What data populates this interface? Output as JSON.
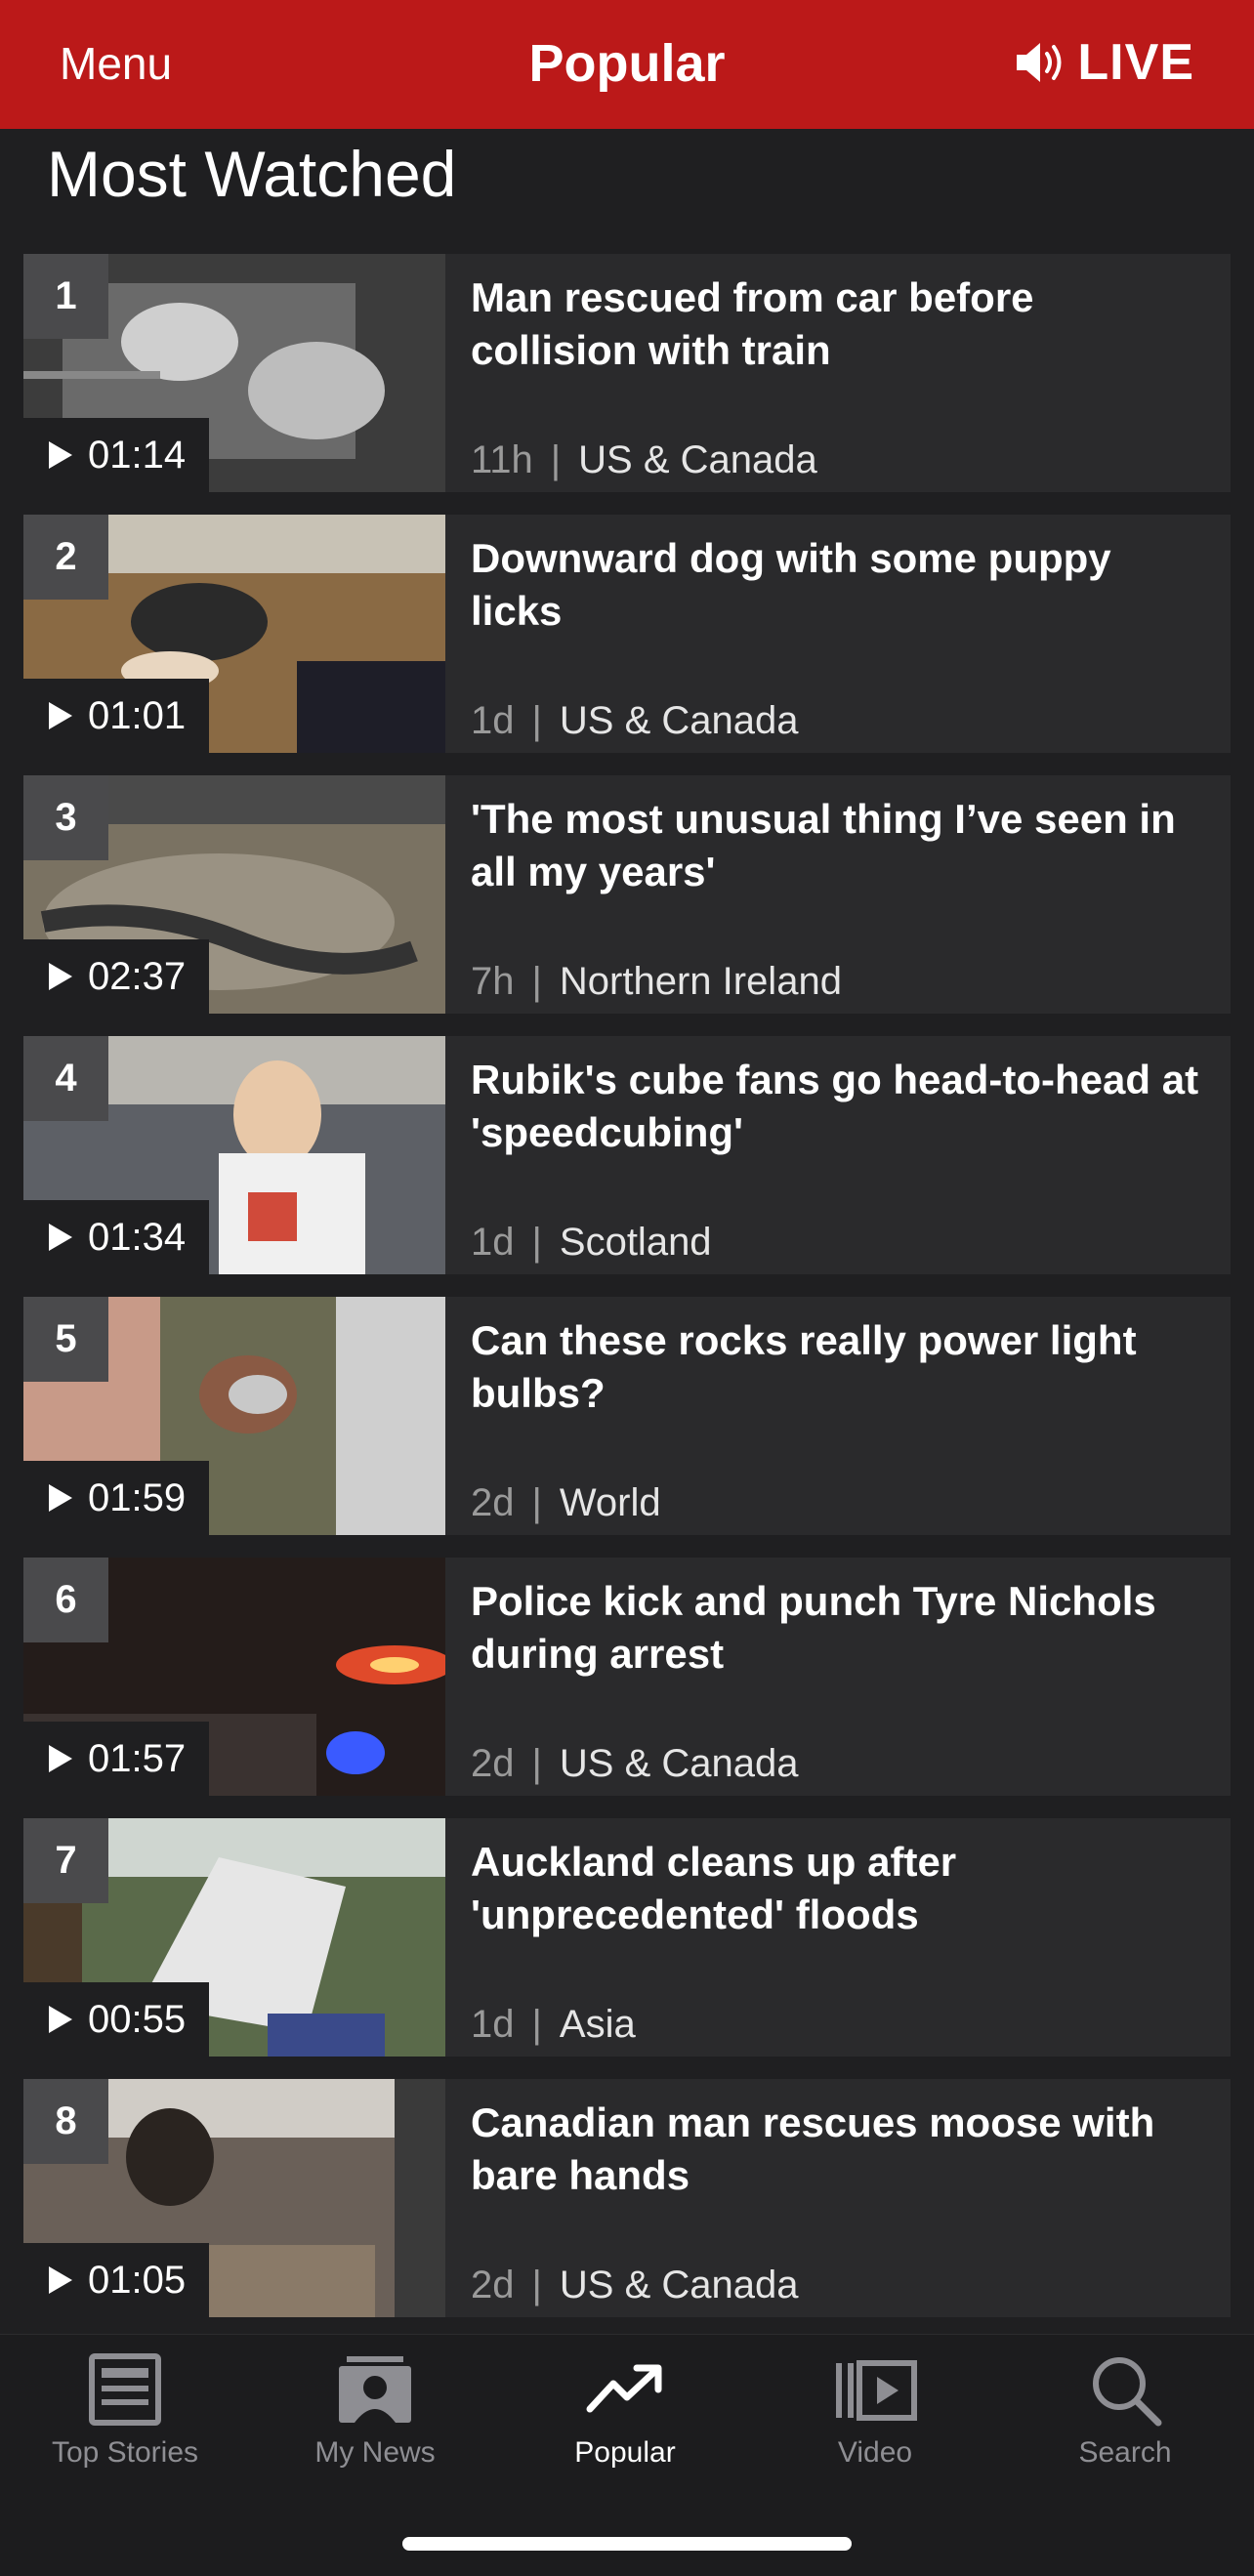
{
  "header": {
    "menu_label": "Menu",
    "title": "Popular",
    "live_label": "LIVE",
    "brand_color": "#bb1919"
  },
  "section": {
    "title": "Most Watched"
  },
  "items": [
    {
      "rank": "1",
      "duration": "01:14",
      "headline": "Man rescued from car before collision with train",
      "age": "11h",
      "region": "US & Canada"
    },
    {
      "rank": "2",
      "duration": "01:01",
      "headline": "Downward dog with some puppy licks",
      "age": "1d",
      "region": "US & Canada"
    },
    {
      "rank": "3",
      "duration": "02:37",
      "headline": "'The most unusual thing I’ve seen in all my years'",
      "age": "7h",
      "region": "Northern Ireland"
    },
    {
      "rank": "4",
      "duration": "01:34",
      "headline": "Rubik's cube fans go head-to-head at 'speedcubing'",
      "age": "1d",
      "region": "Scotland"
    },
    {
      "rank": "5",
      "duration": "01:59",
      "headline": "Can these rocks really power light bulbs?",
      "age": "2d",
      "region": "World"
    },
    {
      "rank": "6",
      "duration": "01:57",
      "headline": "Police kick and punch Tyre Nichols during arrest",
      "age": "2d",
      "region": "US & Canada"
    },
    {
      "rank": "7",
      "duration": "00:55",
      "headline": "Auckland cleans up after 'unprecedented' floods",
      "age": "1d",
      "region": "Asia"
    },
    {
      "rank": "8",
      "duration": "01:05",
      "headline": "Canadian man rescues moose with bare hands",
      "age": "2d",
      "region": "US & Canada"
    }
  ],
  "tabs": [
    {
      "label": "Top Stories",
      "icon": "newspaper-icon",
      "active": false
    },
    {
      "label": "My News",
      "icon": "my-news-icon",
      "active": false
    },
    {
      "label": "Popular",
      "icon": "trending-icon",
      "active": true
    },
    {
      "label": "Video",
      "icon": "video-icon",
      "active": false
    },
    {
      "label": "Search",
      "icon": "search-icon",
      "active": false
    }
  ],
  "separator": "|"
}
